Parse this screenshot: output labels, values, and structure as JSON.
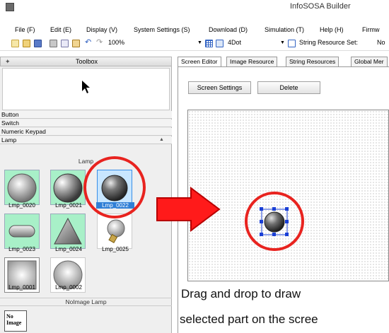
{
  "window": {
    "title": "InfoSOSA Builder"
  },
  "menu": [
    {
      "label": "File (F)"
    },
    {
      "label": "Edit (E)"
    },
    {
      "label": "Display (V)"
    },
    {
      "label": "System Settings (S)"
    },
    {
      "label": "Download (D)"
    },
    {
      "label": "Simulation (T)"
    },
    {
      "label": "Help (H)"
    },
    {
      "label": "Firmw"
    }
  ],
  "toolbar": {
    "zoom": "100%",
    "grid": "4Dot",
    "string_resource_label": "String Resource Set:",
    "string_resource_value": "No"
  },
  "toolbox": {
    "title": "Toolbox",
    "categories": [
      "Button",
      "Switch",
      "Numeric Keypad",
      "Lamp"
    ],
    "lamp_header": "Lamp",
    "lamps": [
      {
        "label": "Lmp_0020"
      },
      {
        "label": "Lmp_0021"
      },
      {
        "label": "Lmp_0022"
      },
      {
        "label": "Lmp_0023"
      },
      {
        "label": "Lmp_0024"
      },
      {
        "label": "Lmp_0025"
      },
      {
        "label": "Lmp_0001"
      },
      {
        "label": "Lmp_0002"
      }
    ],
    "noimage_header": "NoImage Lamp",
    "noimage_text": "No\nImage"
  },
  "editor": {
    "tabs": [
      "Screen Editor",
      "Image Resource",
      "String Resources",
      "Global Mer"
    ],
    "screen_settings_button": "Screen Settings",
    "delete_button": "Delete"
  },
  "instruction": {
    "line1": "Drag  and  drop  to  draw",
    "line2": "selected part on the scree"
  },
  "colors": {
    "accent_red": "#e8231f",
    "selection_blue": "#1a3fd6"
  }
}
